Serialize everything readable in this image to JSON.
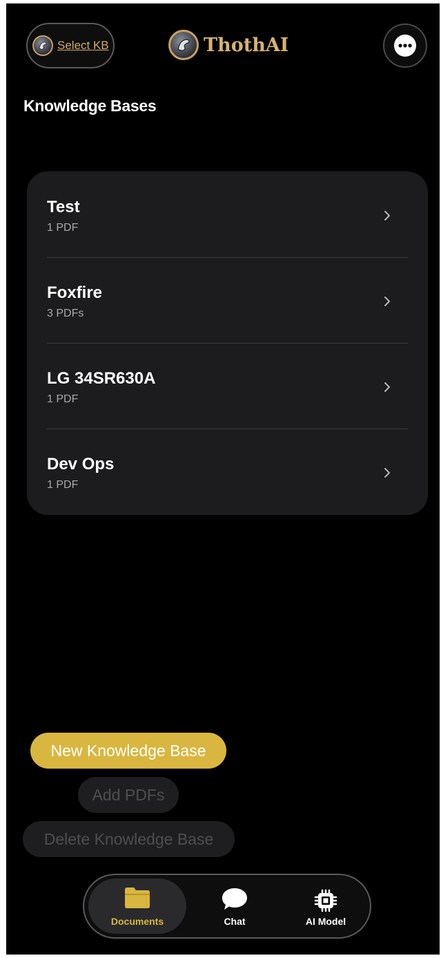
{
  "header": {
    "kb_select_label": "Select KB",
    "brand_name": "ThothAI",
    "more_icon": "ellipsis-circle-icon"
  },
  "page_title": "Knowledge Bases",
  "knowledge_bases": [
    {
      "name": "Test",
      "count": "1 PDF"
    },
    {
      "name": "Foxfire",
      "count": "3 PDFs"
    },
    {
      "name": "LG 34SR630A",
      "count": "1 PDF"
    },
    {
      "name": "Dev Ops",
      "count": "1 PDF"
    }
  ],
  "actions": {
    "new_kb": "New Knowledge Base",
    "add_pdfs": "Add PDFs",
    "delete_kb": "Delete Knowledge Base"
  },
  "tabs": [
    {
      "label": "Documents",
      "icon": "folder-icon",
      "active": true
    },
    {
      "label": "Chat",
      "icon": "chat-bubble-icon",
      "active": false
    },
    {
      "label": "AI Model",
      "icon": "chip-icon",
      "active": false
    }
  ],
  "colors": {
    "accent": "#d9b640",
    "brand_gold": "#d7b275",
    "card_bg": "#1c1c1e",
    "disabled_text": "#4e4e52"
  }
}
